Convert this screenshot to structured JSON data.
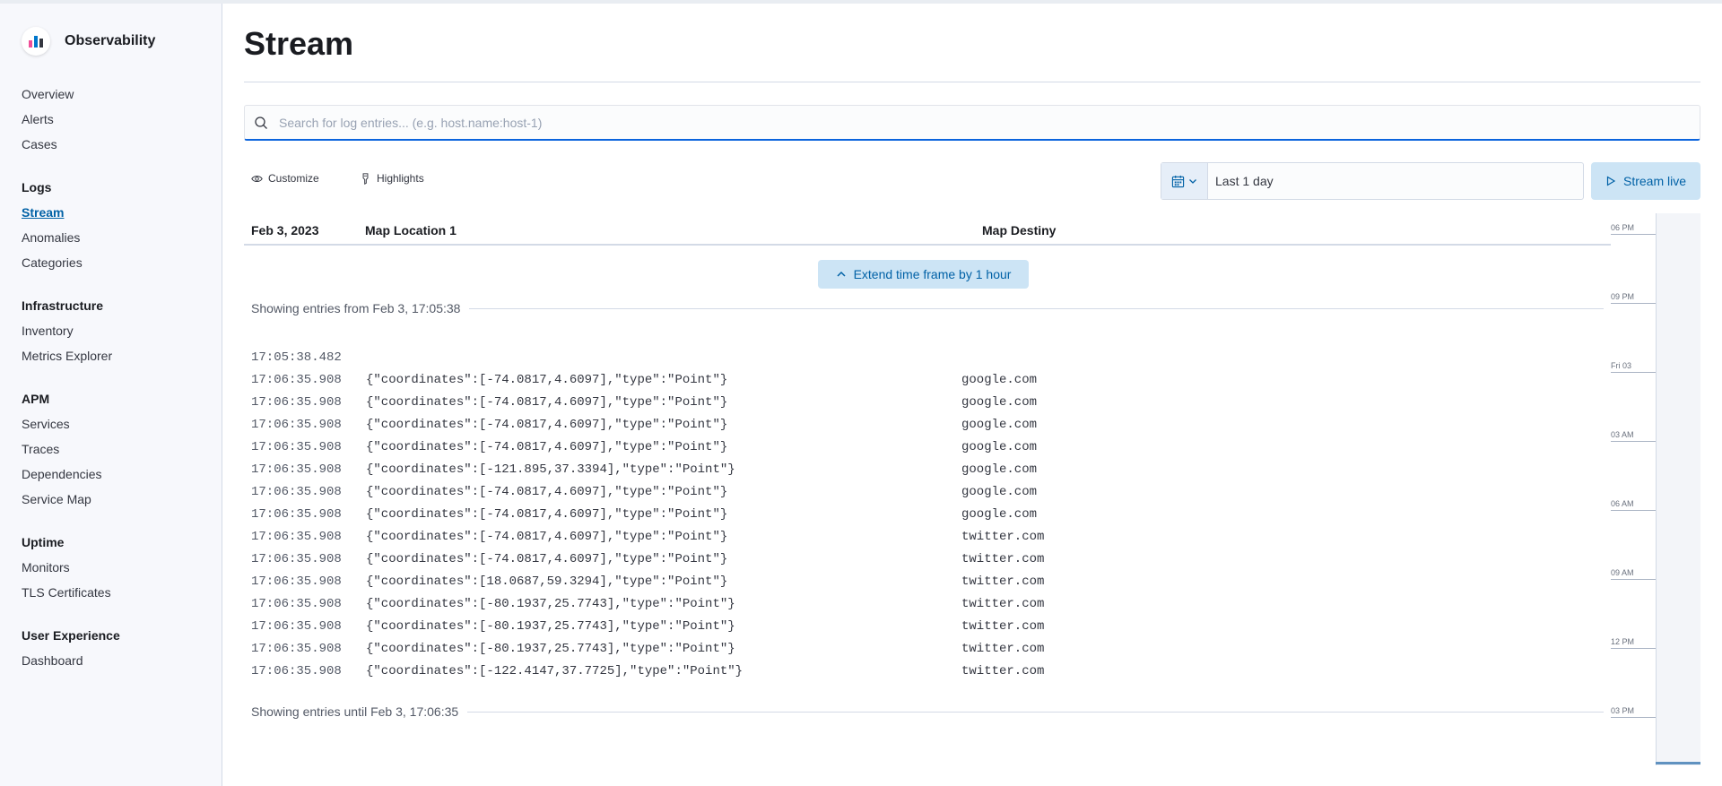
{
  "app": {
    "name": "Observability"
  },
  "sidebar": {
    "groups": [
      {
        "items": [
          {
            "label": "Overview"
          },
          {
            "label": "Alerts"
          },
          {
            "label": "Cases"
          }
        ]
      },
      {
        "title": "Logs",
        "items": [
          {
            "label": "Stream"
          },
          {
            "label": "Anomalies"
          },
          {
            "label": "Categories"
          }
        ]
      },
      {
        "title": "Infrastructure",
        "items": [
          {
            "label": "Inventory"
          },
          {
            "label": "Metrics Explorer"
          }
        ]
      },
      {
        "title": "APM",
        "items": [
          {
            "label": "Services"
          },
          {
            "label": "Traces"
          },
          {
            "label": "Dependencies"
          },
          {
            "label": "Service Map"
          }
        ]
      },
      {
        "title": "Uptime",
        "items": [
          {
            "label": "Monitors"
          },
          {
            "label": "TLS Certificates"
          }
        ]
      },
      {
        "title": "User Experience",
        "items": [
          {
            "label": "Dashboard"
          }
        ]
      }
    ],
    "active": "Stream"
  },
  "page": {
    "title": "Stream"
  },
  "search": {
    "placeholder": "Search for log entries... (e.g. host.name:host-1)",
    "value": ""
  },
  "toolbar": {
    "customize_label": "Customize",
    "highlights_label": "Highlights"
  },
  "date_picker": {
    "value": "Last 1 day"
  },
  "stream_live": {
    "label": "Stream live"
  },
  "log_table": {
    "columns": {
      "date": "Feb 3, 2023",
      "location": "Map Location 1",
      "destiny": "Map Destiny"
    },
    "extend_label": "Extend time frame by 1 hour",
    "showing_from": "Showing entries from Feb 3, 17:05:38",
    "showing_until": "Showing entries until Feb 3, 17:06:35",
    "rows": [
      {
        "ts": "17:05:38.482",
        "msg": "",
        "dest": ""
      },
      {
        "ts": "17:06:35.908",
        "msg": "{\"coordinates\":[-74.0817,4.6097],\"type\":\"Point\"}",
        "dest": "google.com"
      },
      {
        "ts": "17:06:35.908",
        "msg": "{\"coordinates\":[-74.0817,4.6097],\"type\":\"Point\"}",
        "dest": "google.com"
      },
      {
        "ts": "17:06:35.908",
        "msg": "{\"coordinates\":[-74.0817,4.6097],\"type\":\"Point\"}",
        "dest": "google.com"
      },
      {
        "ts": "17:06:35.908",
        "msg": "{\"coordinates\":[-74.0817,4.6097],\"type\":\"Point\"}",
        "dest": "google.com"
      },
      {
        "ts": "17:06:35.908",
        "msg": "{\"coordinates\":[-121.895,37.3394],\"type\":\"Point\"}",
        "dest": "google.com"
      },
      {
        "ts": "17:06:35.908",
        "msg": "{\"coordinates\":[-74.0817,4.6097],\"type\":\"Point\"}",
        "dest": "google.com"
      },
      {
        "ts": "17:06:35.908",
        "msg": "{\"coordinates\":[-74.0817,4.6097],\"type\":\"Point\"}",
        "dest": "google.com"
      },
      {
        "ts": "17:06:35.908",
        "msg": "{\"coordinates\":[-74.0817,4.6097],\"type\":\"Point\"}",
        "dest": "twitter.com"
      },
      {
        "ts": "17:06:35.908",
        "msg": "{\"coordinates\":[-74.0817,4.6097],\"type\":\"Point\"}",
        "dest": "twitter.com"
      },
      {
        "ts": "17:06:35.908",
        "msg": "{\"coordinates\":[18.0687,59.3294],\"type\":\"Point\"}",
        "dest": "twitter.com"
      },
      {
        "ts": "17:06:35.908",
        "msg": "{\"coordinates\":[-80.1937,25.7743],\"type\":\"Point\"}",
        "dest": "twitter.com"
      },
      {
        "ts": "17:06:35.908",
        "msg": "{\"coordinates\":[-80.1937,25.7743],\"type\":\"Point\"}",
        "dest": "twitter.com"
      },
      {
        "ts": "17:06:35.908",
        "msg": "{\"coordinates\":[-80.1937,25.7743],\"type\":\"Point\"}",
        "dest": "twitter.com"
      },
      {
        "ts": "17:06:35.908",
        "msg": "{\"coordinates\":[-122.4147,37.7725],\"type\":\"Point\"}",
        "dest": "twitter.com"
      }
    ]
  },
  "minimap": {
    "ticks": [
      "06 PM",
      "09 PM",
      "Fri 03",
      "03 AM",
      "06 AM",
      "09 AM",
      "12 PM",
      "03 PM"
    ]
  },
  "colors": {
    "accent": "#0061a6",
    "accent_bg": "#cce4f5",
    "search_underline": "#0b64dd"
  },
  "icons": {
    "logo": "observability-logo-icon",
    "search": "search-icon",
    "customize": "eye-icon",
    "highlights": "highlighter-icon",
    "calendar": "calendar-icon",
    "chevron": "chevron-down-icon",
    "play": "play-icon",
    "chevron_up": "chevron-up-icon"
  }
}
